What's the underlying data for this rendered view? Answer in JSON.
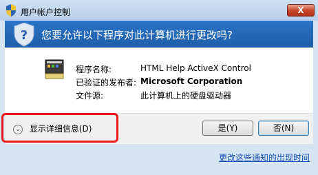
{
  "window": {
    "title": "用户帐户控制",
    "close_label": "X"
  },
  "header": {
    "question": "您要允许以下程序对此计算机进行更改吗?"
  },
  "details_info": {
    "labels": {
      "program_name": "程序名称:",
      "publisher": "已验证的发布者:",
      "source": "文件源:"
    },
    "values": {
      "program_name": "HTML Help ActiveX Control",
      "publisher": "Microsoft Corporation",
      "source": "此计算机上的硬盘驱动器"
    }
  },
  "footer": {
    "show_details": "显示详细信息(D)",
    "yes_label": "是(Y)",
    "no_label": "否(N)"
  },
  "link": {
    "change_notifications": "更改这些通知的出现时间"
  },
  "colors": {
    "header_blue": "#2a73c5",
    "highlight_red": "#e8171b",
    "link_blue": "#1a55b5"
  },
  "icons": [
    "uac-shield-icon",
    "close-icon",
    "question-shield-icon",
    "program-icon",
    "expand-chevron-icon"
  ]
}
